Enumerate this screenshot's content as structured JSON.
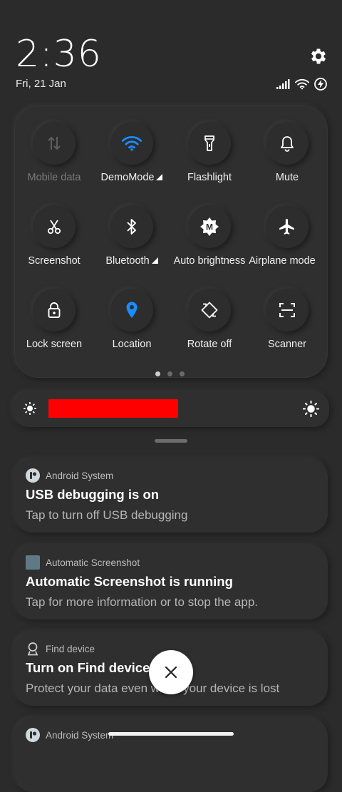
{
  "status": {
    "time": "2:36",
    "date": "Fri, 21 Jan"
  },
  "quick_settings": {
    "tiles": [
      {
        "label": "Mobile data",
        "icon": "mobile-data-icon",
        "state": "disabled"
      },
      {
        "label": "DemoMode",
        "icon": "wifi-icon",
        "state": "active"
      },
      {
        "label": "Flashlight",
        "icon": "flashlight-icon",
        "state": "off"
      },
      {
        "label": "Mute",
        "icon": "bell-icon",
        "state": "off"
      },
      {
        "label": "Screenshot",
        "icon": "scissors-icon",
        "state": "off"
      },
      {
        "label": "Bluetooth",
        "icon": "bluetooth-icon",
        "state": "off"
      },
      {
        "label": "Auto brightness",
        "icon": "auto-brightness-icon",
        "state": "off"
      },
      {
        "label": "Airplane mode",
        "icon": "airplane-icon",
        "state": "off"
      },
      {
        "label": "Lock screen",
        "icon": "lock-icon",
        "state": "off"
      },
      {
        "label": "Location",
        "icon": "location-icon",
        "state": "active"
      },
      {
        "label": "Rotate off",
        "icon": "rotate-icon",
        "state": "off"
      },
      {
        "label": "Scanner",
        "icon": "scanner-icon",
        "state": "off"
      }
    ],
    "page_count": 3,
    "active_page": 1
  },
  "brightness": {
    "low_icon": "brightness-low-icon",
    "high_icon": "brightness-high-icon"
  },
  "notifications": [
    {
      "app": "Android System",
      "title": "USB debugging is on",
      "text": "Tap to turn off USB debugging"
    },
    {
      "app": "Automatic Screenshot",
      "title": "Automatic Screenshot is running",
      "text": "Tap for more information or to stop the app."
    },
    {
      "app": "Find device",
      "title": "Turn on Find device",
      "text": "Protect your data even when your device is lost"
    },
    {
      "app": "Android System",
      "title": "",
      "text": ""
    }
  ],
  "colors": {
    "accent": "#1a8cff",
    "background": "#2b2b2b",
    "redaction": "#ff0000"
  }
}
